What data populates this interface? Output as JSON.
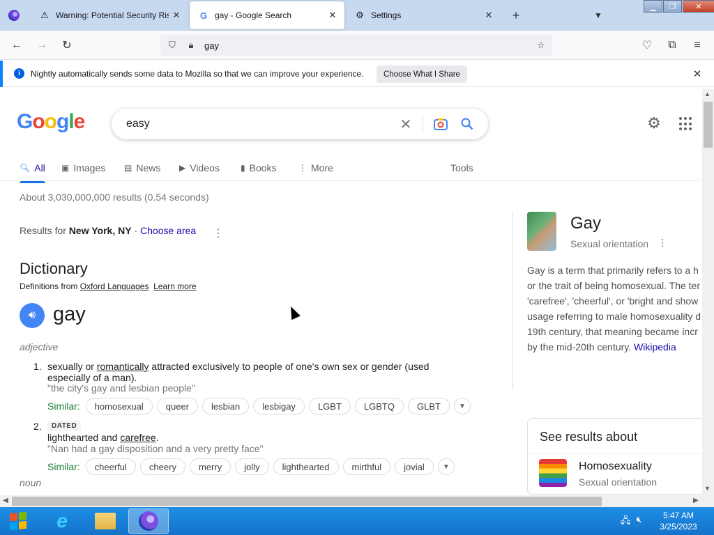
{
  "browser": {
    "tabs": [
      {
        "title": "Warning: Potential Security Risk",
        "icon": "warning-icon"
      },
      {
        "title": "gay - Google Search",
        "icon": "google-g-icon"
      },
      {
        "title": "Settings",
        "icon": "gear-icon"
      }
    ],
    "url": "gay"
  },
  "notification": {
    "text": "Nightly automatically sends some data to Mozilla so that we can improve your experience.",
    "button": "Choose What I Share"
  },
  "search": {
    "logo": "Google",
    "query": "easy",
    "tabs": [
      "All",
      "Images",
      "News",
      "Videos",
      "Books",
      "More"
    ],
    "tools": "Tools",
    "results_count": "About 3,030,000,000 results (0.54 seconds)",
    "location_prefix": "Results for",
    "location": "New York, NY",
    "location_sep": "·",
    "choose_area": "Choose area"
  },
  "dictionary": {
    "title": "Dictionary",
    "source_prefix": "Definitions from",
    "source": "Oxford Languages",
    "learn_more": "Learn more",
    "word": "gay",
    "pos": "adjective",
    "def1_num": "1.",
    "def1_text_a": "sexually or ",
    "def1_text_link": "romantically",
    "def1_text_b": " attracted exclusively to people of one's own sex or gender (used",
    "def1_text_c": "especially of a man).",
    "def1_example": "\"the city's gay and lesbian people\"",
    "similar_label": "Similar:",
    "def1_similar": [
      "homosexual",
      "queer",
      "lesbian",
      "lesbigay",
      "LGBT",
      "LGBTQ",
      "GLBT"
    ],
    "def2_num": "2.",
    "def2_tag": "DATED",
    "def2_text_a": "lighthearted and ",
    "def2_text_link": "carefree",
    "def2_text_b": ".",
    "def2_example": "\"Nan had a gay disposition and a very pretty face\"",
    "def2_similar": [
      "cheerful",
      "cheery",
      "merry",
      "jolly",
      "lighthearted",
      "mirthful",
      "jovial"
    ],
    "pos2": "noun"
  },
  "knowledge_panel": {
    "title": "Gay",
    "subtitle": "Sexual orientation",
    "desc_lines": [
      "Gay is a term that primarily refers to a h",
      "or the trait of being homosexual. The ter",
      "'carefree', 'cheerful', or 'bright and show",
      "usage referring to male homosexuality d",
      "19th century, that meaning became incr",
      "by the mid-20th century. "
    ],
    "source_link": "Wikipedia",
    "see_results_title": "See results about",
    "see_results_name": "Homosexuality",
    "see_results_sub": "Sexual orientation"
  },
  "taskbar": {
    "time": "5:47 AM",
    "date": "3/25/2023"
  }
}
